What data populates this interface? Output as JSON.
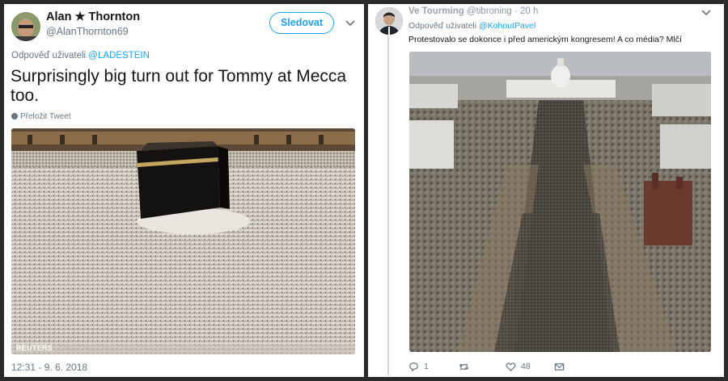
{
  "left_tweet": {
    "author_name": "Alan ★ Thornton",
    "author_handle": "@AlanThornton69",
    "follow_label": "Sledovat",
    "replying_prefix": "Odpověď uživateli",
    "replying_to": "@LADESTEIN",
    "text": "Surprisingly big turn out for Tommy at Mecca too.",
    "translate_label": "Přeložit Tweet",
    "image_watermark": "REUTERS",
    "timestamp": "12:31 - 9. 6. 2018",
    "icons": [
      "avatar",
      "chevron-down-icon",
      "globe-icon"
    ]
  },
  "right_tweet": {
    "author_name_obscured": "Ve Tourming",
    "author_handle_obscured": "@tibroning",
    "time_ago": "· 20 h",
    "replying_prefix": "Odpověď uživateli",
    "replying_to": "@KohoutPavel",
    "text": "Protestovalo se dokonce i před americkým kongresem! A co média? Mlčí",
    "reply_count": "1",
    "retweet_count": "",
    "like_count": "48",
    "icons": [
      "reply-icon",
      "retweet-icon",
      "like-icon",
      "message-icon",
      "chevron-down-icon"
    ]
  },
  "colors": {
    "link_blue": "#1da1f2",
    "secondary_text": "#657786",
    "primary_text": "#14171a",
    "frame_bg": "#2b2b2b"
  }
}
